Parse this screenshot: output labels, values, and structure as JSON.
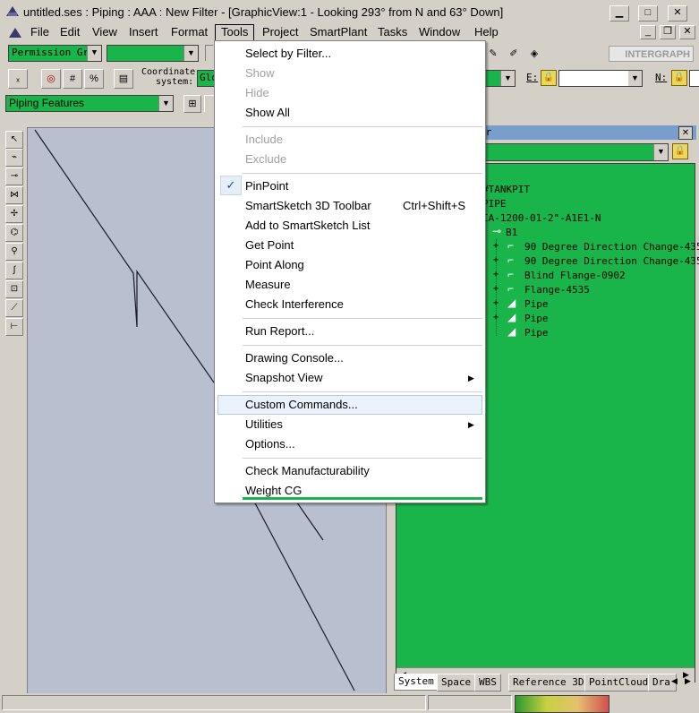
{
  "window": {
    "title": "untitled.ses : Piping : AAA : New Filter - [GraphicView:1 - Looking 293° from N and 63° Down]"
  },
  "menubar": {
    "items": [
      {
        "label": "File"
      },
      {
        "label": "Edit"
      },
      {
        "label": "View"
      },
      {
        "label": "Insert"
      },
      {
        "label": "Format"
      },
      {
        "label": "Tools"
      },
      {
        "label": "Project"
      },
      {
        "label": "SmartPlant"
      },
      {
        "label": "Tasks"
      },
      {
        "label": "Window"
      },
      {
        "label": "Help"
      }
    ],
    "active": "Tools"
  },
  "toolbar": {
    "permission_group": "Permission Gro",
    "coordinate_label_1": "Coordinate",
    "coordinate_label_2": "system:",
    "coordinate_value": "Glo",
    "e_label": "E:",
    "n_label": "N:",
    "piping_features": "Piping Features",
    "brand": "INTERGRAPH"
  },
  "tools_menu": {
    "groups": [
      [
        {
          "label": "Select by Filter...",
          "enabled": true
        },
        {
          "label": "Show",
          "enabled": false
        },
        {
          "label": "Hide",
          "enabled": false
        },
        {
          "label": "Show All",
          "enabled": true
        }
      ],
      [
        {
          "label": "Include",
          "enabled": false
        },
        {
          "label": "Exclude",
          "enabled": false
        }
      ],
      [
        {
          "label": "PinPoint",
          "enabled": true,
          "checked": true
        },
        {
          "label": "SmartSketch 3D Toolbar",
          "enabled": true,
          "shortcut": "Ctrl+Shift+S"
        },
        {
          "label": "Add to SmartSketch List",
          "enabled": true
        },
        {
          "label": "Get Point",
          "enabled": true
        },
        {
          "label": "Point Along",
          "enabled": true
        },
        {
          "label": "Measure",
          "enabled": true
        },
        {
          "label": "Check Interference",
          "enabled": true
        }
      ],
      [
        {
          "label": "Run Report...",
          "enabled": true
        }
      ],
      [
        {
          "label": "Drawing Console...",
          "enabled": true
        },
        {
          "label": "Snapshot View",
          "enabled": true,
          "submenu": true
        }
      ],
      [
        {
          "label": "Custom Commands...",
          "enabled": true,
          "highlighted": true
        },
        {
          "label": "Utilities",
          "enabled": true,
          "submenu": true
        },
        {
          "label": "Options...",
          "enabled": true
        }
      ],
      [
        {
          "label": "Check Manufacturability",
          "enabled": true
        },
        {
          "label": "Weight  CG",
          "enabled": true
        }
      ]
    ]
  },
  "explorer": {
    "title_suffix": "er",
    "tree": [
      {
        "label": "#TANKPIT"
      },
      {
        "label": "PIPE"
      },
      {
        "label": "IA-1200-01-2\"-A1E1-N"
      },
      {
        "label": "B1"
      },
      {
        "label": "90 Degree Direction Change-4355"
      },
      {
        "label": "90 Degree Direction Change-4357"
      },
      {
        "label": "Blind Flange-0902"
      },
      {
        "label": "Flange-4535"
      },
      {
        "label": "Pipe"
      },
      {
        "label": "Pipe"
      },
      {
        "label": "Pipe"
      }
    ],
    "tabs": [
      "System",
      "Space",
      "WBS",
      "Reference 3D",
      "PointCloud",
      "Dra"
    ]
  },
  "colors": {
    "accent_green": "#1ab54a",
    "view_background": "#b8bfcf",
    "menu_highlight": "#e9f1fb"
  }
}
